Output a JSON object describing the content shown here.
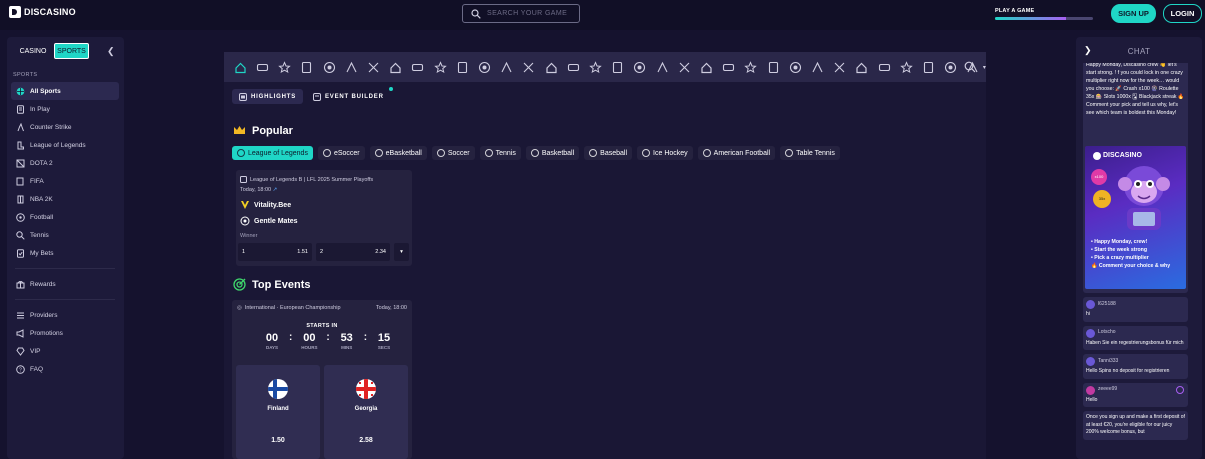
{
  "header": {
    "logo_text": "DISCASINO",
    "search_placeholder": "SEARCH YOUR GAME",
    "play_game_label": "PLAY A GAME",
    "play_game_progress": 0.72,
    "signup_label": "SIGN UP",
    "login_label": "LOGIN"
  },
  "sidebar": {
    "tab_casino": "CASINO",
    "tab_sports": "SPORTS",
    "collapse_icon": "chevron-left-icon",
    "section_label": "SPORTS",
    "items": [
      {
        "label": "All Sports",
        "icon": "globe-icon",
        "active": true
      },
      {
        "label": "In Play",
        "icon": "document-icon"
      },
      {
        "label": "Counter Strike",
        "icon": "soldier-icon"
      },
      {
        "label": "League of Legends",
        "icon": "lol-icon"
      },
      {
        "label": "DOTA 2",
        "icon": "dota-icon"
      },
      {
        "label": "FIFA",
        "icon": "fifa-icon"
      },
      {
        "label": "NBA 2K",
        "icon": "nba-icon"
      },
      {
        "label": "Football",
        "icon": "football-icon"
      },
      {
        "label": "Tennis",
        "icon": "tennis-icon"
      },
      {
        "label": "My Bets",
        "icon": "bets-icon"
      }
    ],
    "rewards": {
      "label": "Rewards",
      "icon": "rewards-icon"
    },
    "more": [
      {
        "label": "Providers",
        "icon": "providers-icon"
      },
      {
        "label": "Promotions",
        "icon": "megaphone-icon"
      },
      {
        "label": "VIP",
        "icon": "diamond-icon"
      },
      {
        "label": "FAQ",
        "icon": "question-icon"
      }
    ]
  },
  "main": {
    "subtabs": {
      "highlights": "HIGHLIGHTS",
      "event_builder": "EVENT BUILDER"
    },
    "popular_title": "Popular",
    "chips": [
      "League of Legends",
      "eSoccer",
      "eBasketball",
      "Soccer",
      "Tennis",
      "Basketball",
      "Baseball",
      "Ice Hockey",
      "American Football",
      "Table Tennis"
    ],
    "popular_match": {
      "league": "League of Legends B | LFL 2025 Summer Playoffs",
      "time": "Today, 18:00",
      "team1": "Vitality.Bee",
      "team2": "Gentle Mates",
      "market": "Winner",
      "odd1_label": "1",
      "odd1_value": "1.51",
      "odd2_label": "2",
      "odd2_value": "2.34"
    },
    "top_events_title": "Top Events",
    "top_event": {
      "competition": "International · European Championship",
      "time": "Today, 18:00",
      "starts_in": "STARTS IN",
      "days": "00",
      "days_label": "DAYS",
      "hours": "00",
      "hours_label": "HOURS",
      "mins": "53",
      "mins_label": "MINS",
      "secs": "15",
      "secs_label": "SECS",
      "team1": "Finland",
      "team1_odd": "1.50",
      "team2": "Georgia",
      "team2_odd": "2.58"
    }
  },
  "chat": {
    "title": "CHAT",
    "promo_text": "Happy Monday, Discasino crew 👋 let's start strong. ! f you could lock in one crazy multiplier right now for the week… would you choose: 🚀 Crash x100 🎡 Roulette 35x 🎰 Slots 1000x 🂡 Blackjack streak 🔥 Comment your pick and tell us why, let's see which team is boldest this Monday!",
    "promo_brand": "DISCASINO",
    "promo_badge1": "x100",
    "promo_badge2": "35x",
    "promo_lines": [
      "• Happy Monday, crew!",
      "• Start the week strong",
      "• Pick a crazy multiplier",
      "🔥 Comment your choice & why"
    ],
    "messages": [
      {
        "user": "l625188",
        "text": "hi"
      },
      {
        "user": "Lotscho",
        "text": "Haben Sie ein regestrierungsbonus für mich"
      },
      {
        "user": "Tanni333",
        "text": "Hello Spins no deposit for registrieren"
      },
      {
        "user": "zeeee99",
        "text": "Hello"
      },
      {
        "user": "",
        "text": "Once you sign up and make a first deposit of at least €20, you're eligible for our juicy 200% welcome bonus, but"
      }
    ]
  }
}
